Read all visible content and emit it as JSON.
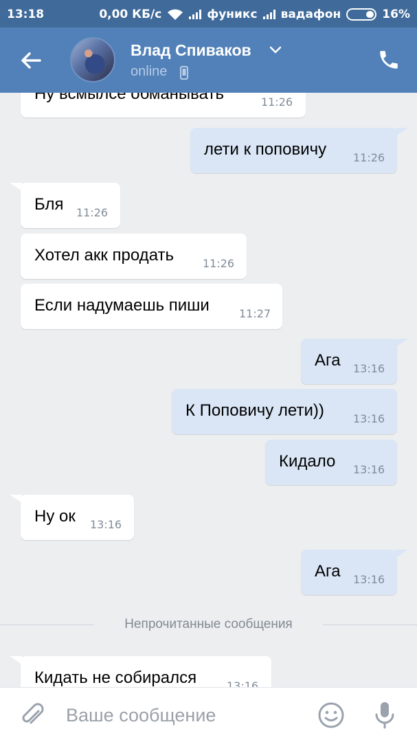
{
  "status_bar": {
    "time": "13:18",
    "speed": "0,00 КБ/с",
    "carrier1": "фуникс",
    "carrier2": "вадафон",
    "battery": "16%"
  },
  "header": {
    "contact_name": "Влад Спиваков",
    "contact_status": "online",
    "icons": [
      "back-arrow-icon",
      "chevron-down-icon",
      "mobile-phone-icon",
      "phone-call-icon"
    ]
  },
  "messages": [
    {
      "dir": "in",
      "text": "Ну всмылсе обманывать",
      "time": "11:26"
    },
    {
      "dir": "out",
      "text": "лети к поповичу",
      "time": "11:26"
    },
    {
      "dir": "in",
      "text": "Бля",
      "time": "11:26"
    },
    {
      "dir": "in",
      "text": "Хотел акк продать",
      "time": "11:26"
    },
    {
      "dir": "in",
      "text": "Если надумаешь пиши",
      "time": "11:27"
    },
    {
      "dir": "out",
      "text": "Ага",
      "time": "13:16"
    },
    {
      "dir": "out",
      "text": "К Поповичу лети))",
      "time": "13:16"
    },
    {
      "dir": "out",
      "text": "Кидало",
      "time": "13:16"
    },
    {
      "dir": "in",
      "text": "Ну ок",
      "time": "13:16"
    },
    {
      "dir": "out",
      "text": "Ага",
      "time": "13:16"
    },
    {
      "dir": "in",
      "text": "Кидать не собирался",
      "time": "13:16"
    }
  ],
  "unread_divider": "Непрочитанные сообщения",
  "composer": {
    "placeholder": "Ваше сообщение",
    "icons": [
      "paperclip-icon",
      "smile-icon",
      "microphone-icon"
    ]
  },
  "colors": {
    "header": "#5181b8",
    "status_bar": "#3f6a99",
    "background": "#edeef0",
    "bubble_in": "#ffffff",
    "bubble_out": "#dae6f6"
  }
}
